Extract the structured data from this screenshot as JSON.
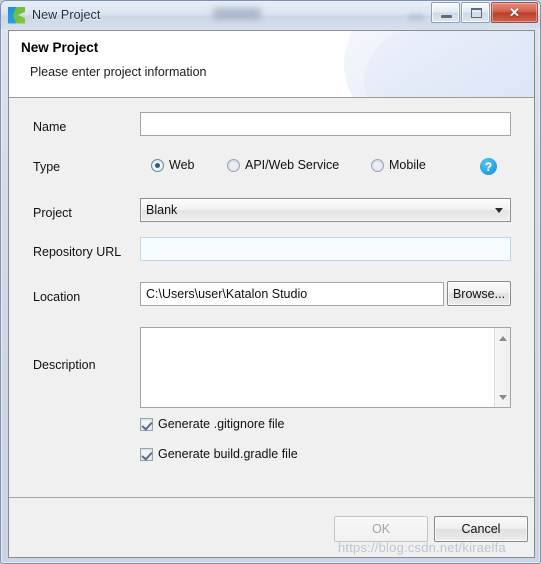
{
  "window": {
    "title": "New Project",
    "app_icon": "katalon-k-logo-icon",
    "controls": {
      "minimize": "minimize-icon",
      "maximize": "maximize-icon",
      "close": "✕"
    }
  },
  "header": {
    "title": "New Project",
    "subtitle": "Please enter project information"
  },
  "form": {
    "name": {
      "label": "Name",
      "value": "",
      "placeholder": ""
    },
    "type": {
      "label": "Type",
      "selected": "Web",
      "options": [
        {
          "label": "Web",
          "selected": true
        },
        {
          "label": "API/Web Service",
          "selected": false
        },
        {
          "label": "Mobile",
          "selected": false
        }
      ],
      "help_icon": "help-circle-icon",
      "help_glyph": "?"
    },
    "project": {
      "label": "Project",
      "value": "Blank",
      "options": [
        "Blank"
      ]
    },
    "repository_url": {
      "label": "Repository URL",
      "value": "",
      "placeholder": "",
      "disabled": true
    },
    "location": {
      "label": "Location",
      "value": "C:\\Users\\user\\Katalon Studio",
      "browse_label": "Browse..."
    },
    "description": {
      "label": "Description",
      "value": "",
      "placeholder": ""
    },
    "checkboxes": [
      {
        "label": "Generate .gitignore file",
        "checked": true
      },
      {
        "label": "Generate build.gradle file",
        "checked": true
      }
    ]
  },
  "footer": {
    "ok_label": "OK",
    "ok_disabled": true,
    "cancel_label": "Cancel"
  },
  "watermark": {
    "text": "https://blog.csdn.net/kiraelfa"
  },
  "colors": {
    "accent_blue": "#2aa5e4",
    "logo_blue": "#2aa3de",
    "logo_green": "#8cc63f",
    "close_red": "#b8402c",
    "dialog_bg": "#f0f0f0"
  }
}
